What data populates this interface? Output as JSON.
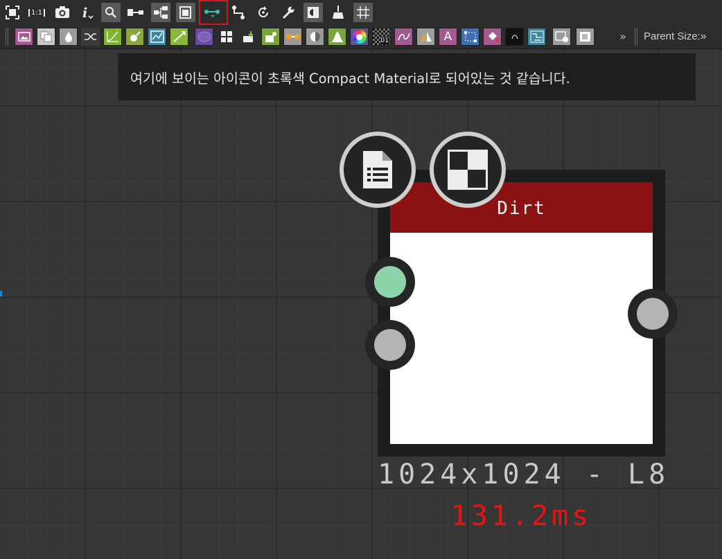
{
  "toolbar_top": {
    "icons": [
      "fit-view-icon",
      "zoom-1-1-icon",
      "camera-icon",
      "info-icon",
      "magnifier-icon",
      "link-nodes-icon",
      "hierarchy-icon",
      "frames-icon",
      "compact-link-icon",
      "connect-icon",
      "rotate-icon",
      "wrench-icon",
      "preview-icon",
      "clean-icon",
      "grid-snap-icon"
    ],
    "zoom_label": "1:1",
    "highlight_color": "#d21919"
  },
  "toolbar_library": {
    "items": [
      "image-icon",
      "layers-icon",
      "drop-icon",
      "shuffle-icon",
      "curve-icon",
      "fx-icon",
      "warp-icon",
      "gradient-icon",
      "circle-icon",
      "tile-icon",
      "import-icon",
      "paint-icon",
      "link-icon",
      "blend-icon",
      "histogram-icon",
      "color-wheel-icon",
      "noise-icon",
      "spline-icon",
      "mirror-icon",
      "text-icon",
      "transform-icon",
      "fill-icon",
      "value-icon",
      "pattern-icon",
      "output-icon",
      "frame-icon"
    ],
    "text_tile": "A",
    "value_tile": "01",
    "more": "»",
    "parent_size_label": "Parent Size:",
    "parent_size_more": "»"
  },
  "tooltip": {
    "text": "여기에 보이는 아이콘이 초록색 Compact Material로 되어있는 것 같습니다."
  },
  "node": {
    "title": "Dirt",
    "resolution": "1024x1024 - L8",
    "time": "131.2ms",
    "header_color": "#8b1113",
    "badges": [
      "document-icon",
      "checker-icon"
    ],
    "inputs": [
      {
        "name": "input-port-1",
        "color": "#8ed4aa"
      },
      {
        "name": "input-port-2",
        "color": "#b4b4b4"
      }
    ],
    "outputs": [
      {
        "name": "output-port",
        "color": "#b4b4b4"
      }
    ]
  }
}
